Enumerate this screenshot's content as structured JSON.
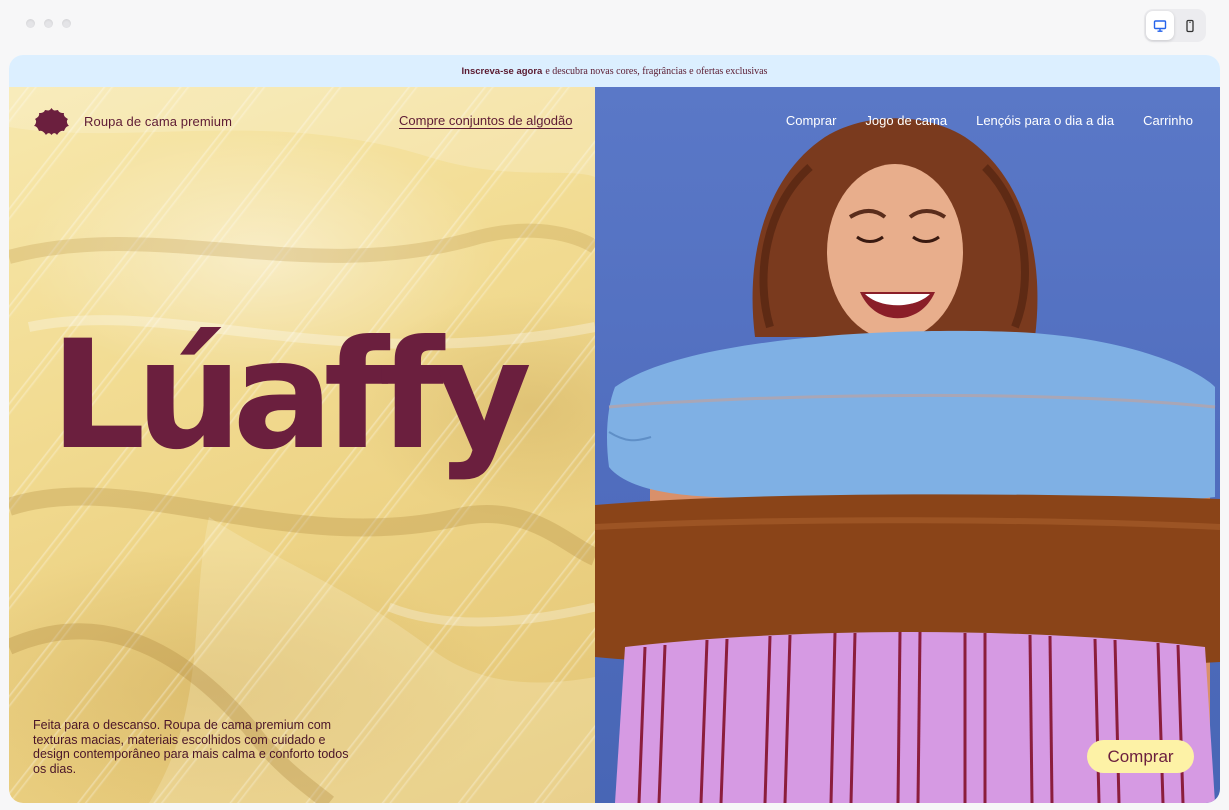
{
  "chrome": {
    "window_dots": [
      "dot",
      "dot",
      "dot"
    ],
    "device_toggle": {
      "active": "desktop",
      "options": [
        "desktop-icon",
        "mobile-icon"
      ]
    }
  },
  "announcement": {
    "strong": "Inscreva-se agora",
    "text": "e descubra novas cores, fragrâncias e ofertas exclusivas"
  },
  "header": {
    "logo_text": "Roupa de cama premium",
    "feature_link": "Compre conjuntos de algodão",
    "nav": [
      "Comprar",
      "Jogo de cama",
      "Lençóis para o dia a dia",
      "Carrinho"
    ]
  },
  "hero": {
    "brand": "Lúaffy",
    "tagline": "Feita para o descanso. Roupa de cama premium com texturas macias, materiais escolhidos com cuidado e design contemporâneo para mais calma e conforto todos os dias.",
    "cta": "Comprar"
  },
  "colors": {
    "brand": "#6b1f3e",
    "announce_bg": "#dcefff",
    "cta_bg": "#fdf2a6",
    "backdrop_blue": "#5a78c7",
    "duvet_yellow": "#f2dc93"
  }
}
